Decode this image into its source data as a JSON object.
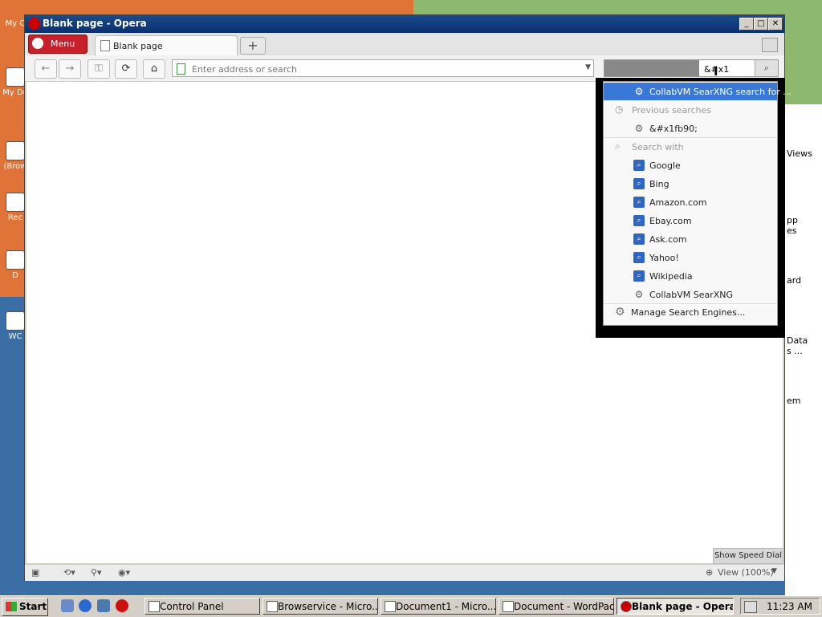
{
  "desktop": {
    "left_icons": [
      {
        "label": "My C"
      },
      {
        "label": "My Do"
      },
      {
        "label": "(Brow"
      },
      {
        "label": "Rec"
      },
      {
        "label": "D"
      },
      {
        "label": "WC"
      }
    ],
    "right_icons": [
      {
        "label": "Views"
      },
      {
        "label": "pp"
      },
      {
        "label": "es"
      },
      {
        "label": "ard"
      },
      {
        "label": "Data"
      },
      {
        "label": "s ..."
      },
      {
        "label": "em"
      }
    ]
  },
  "window": {
    "title": "Blank page - Opera",
    "controls": {
      "minimize": "_",
      "maximize": "□",
      "close": "✕"
    }
  },
  "tabbar": {
    "menu_label": "Menu",
    "tabs": [
      {
        "label": "Blank page"
      }
    ],
    "new_tab": "+"
  },
  "toolbar": {
    "back": "←",
    "forward": "→",
    "key": "⚿",
    "reload": "⟳",
    "home": "⌂",
    "address_placeholder": "Enter address or search",
    "search_value": "&#x1"
  },
  "search_dropdown": {
    "top_suggestion": "CollabVM SearXNG search for ...",
    "previous_header": "Previous searches",
    "previous": [
      {
        "label": "&#x1fb90;"
      }
    ],
    "search_with_header": "Search with",
    "engines": [
      {
        "label": "Google",
        "icon": "search-icon"
      },
      {
        "label": "Bing",
        "icon": "search-icon"
      },
      {
        "label": "Amazon.com",
        "icon": "search-icon"
      },
      {
        "label": "Ebay.com",
        "icon": "search-icon"
      },
      {
        "label": "Ask.com",
        "icon": "search-icon"
      },
      {
        "label": "Yahoo!",
        "icon": "search-icon"
      },
      {
        "label": "Wikipedia",
        "icon": "search-icon"
      },
      {
        "label": "CollabVM SearXNG",
        "icon": "searxng-icon"
      }
    ],
    "manage": "Manage Search Engines..."
  },
  "statusbar": {
    "speed_dial": "Show Speed Dial",
    "view": "View (100%)"
  },
  "taskbar": {
    "start": "Start",
    "tasks": [
      {
        "label": "Control Panel"
      },
      {
        "label": "Browservice - Micro..."
      },
      {
        "label": "Document1 - Micro..."
      },
      {
        "label": "Document - WordPad"
      },
      {
        "label": "Blank page - Opera"
      }
    ],
    "clock": "11:23 AM"
  }
}
